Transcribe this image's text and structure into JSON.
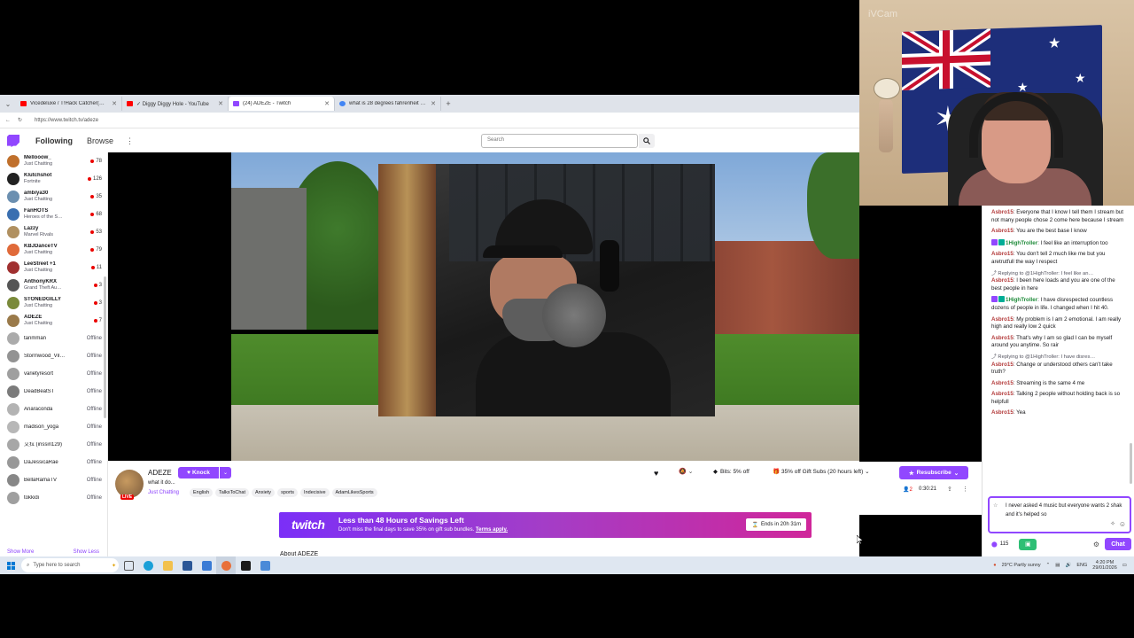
{
  "browser": {
    "tabs": [
      {
        "label": "Vicedeluxe / T!Hack Catcher(Ghost…",
        "color": "#ff0000"
      },
      {
        "label": "✓ Diggy Diggy Hole - YouTube",
        "color": "#ff0000"
      },
      {
        "label": "(24) ADEZE - Twitch",
        "color": "#9147ff"
      },
      {
        "label": "what is 28 degrees fahrenheit - G…",
        "color": "#4285f4"
      }
    ],
    "url": "https://www.twitch.tv/adeze"
  },
  "topnav": {
    "following": "Following",
    "browse": "Browse",
    "search_placeholder": "Search"
  },
  "sidebar": {
    "channels": [
      {
        "name": "Mellooow_",
        "game": "Just Chatting",
        "viewers": "78",
        "color": "#c0702c"
      },
      {
        "name": "Klutchshot",
        "game": "Fortnite",
        "viewers": "126",
        "color": "#222"
      },
      {
        "name": "ambiya30",
        "game": "Just Chatting",
        "viewers": "35",
        "color": "#6b8fb0"
      },
      {
        "name": "FanHOTS",
        "game": "Heroes of the S…",
        "viewers": "68",
        "color": "#3a6fb0"
      },
      {
        "name": "Lazzy",
        "game": "Marvel Rivals",
        "viewers": "53",
        "color": "#b09060"
      },
      {
        "name": "KBJDanceTV",
        "game": "Just Chatting",
        "viewers": "79",
        "color": "#e06a3a"
      },
      {
        "name": "LeeStreet +1",
        "game": "Just Chatting",
        "viewers": "11",
        "color": "#a03030"
      },
      {
        "name": "AnthonyKRX",
        "game": "Grand Theft Au…",
        "viewers": "3",
        "color": "#555"
      },
      {
        "name": "STONEDGILLY",
        "game": "Just Chatting",
        "viewers": "3",
        "color": "#7a8a3a"
      },
      {
        "name": "ADEZE",
        "game": "Just Chatting",
        "viewers": "7",
        "color": "#9a7a4a"
      }
    ],
    "offline": [
      {
        "name": "tanmman",
        "status": "Offline",
        "color": "#888"
      },
      {
        "name": "Stormwood_Vil…",
        "status": "Offline",
        "color": "#666"
      },
      {
        "name": "varietyresort",
        "status": "Offline",
        "color": "#777"
      },
      {
        "name": "DeadBeatST",
        "status": "Offline",
        "color": "#444"
      },
      {
        "name": "Anaraconda",
        "status": "Offline",
        "color": "#995"
      },
      {
        "name": "madison_yoga",
        "status": "Offline",
        "color": "#999"
      },
      {
        "name": "艾拉 (irissiri129)",
        "status": "Offline",
        "color": "#a77"
      },
      {
        "name": "DaJessicaRae",
        "status": "Offline",
        "color": "#866"
      },
      {
        "name": "BellaRamaTV",
        "status": "Offline",
        "color": "#555"
      },
      {
        "name": "tokkidi",
        "status": "Offline",
        "color": "#777"
      }
    ],
    "show_more": "Show More",
    "show_less": "Show Less"
  },
  "channel": {
    "name": "ADEZE",
    "knock": "Knock",
    "title": "what it do...",
    "category": "Just Chatting",
    "live": "LIVE",
    "tags": [
      "English",
      "TalksToChat",
      "Anxiety",
      "sports",
      "Indecisive",
      "AdamLikesSports"
    ],
    "bits": "Bits: 5% off",
    "gift_subs": "35% off Gift Subs (20 hours left)",
    "resubscribe": "Resubscribe",
    "viewers": "2",
    "uptime": "0:30:21"
  },
  "banner": {
    "brand": "twitch",
    "headline": "Less than 48 Hours of Savings Left",
    "sub": "Don't miss the final days to save 35% on gift sub bundles.",
    "terms": "Terms apply.",
    "ends": "Ends in 20h 31m"
  },
  "about_peek": "About ADEZE",
  "chat": {
    "messages": [
      {
        "user": "Asbro15",
        "text": ": Everyone that I know I tell them I stream but not many people chose 2 come here because I stream"
      },
      {
        "user": "Asbro15",
        "text": ": You are the best base I know"
      },
      {
        "user": "1HighTroller",
        "text": ": I feel like an interruption too"
      },
      {
        "user": "Asbro15",
        "text": ": You don't tell 2 much like me but you aretrutfull the way I respect"
      },
      {
        "reply": "Replying to @1HighTroller: I feel like an…",
        "user": "Asbro15",
        "text": ": I been here loads and you are one of the best people in here"
      },
      {
        "user": "1HighTroller",
        "text": ": I have disrespected countless dozens of people in life. I changed when I hit 40."
      },
      {
        "user": "Asbro15",
        "text": ": My problem is I am 2 emotional. I am really high and really low 2 quick"
      },
      {
        "user": "Asbro15",
        "text": ": That's why I am so glad I can be myself around you anytime. So rair"
      },
      {
        "reply": "Replying to @1HighTroller: I have disres…",
        "user": "Asbro15",
        "text": ": Change or understood others can't take truth?"
      },
      {
        "user": "Asbro15",
        "text": ": Streaming is the same 4 me"
      },
      {
        "user": "Asbro15",
        "text": ": Talking 2 people without holding back is so helpfull"
      },
      {
        "user": "Asbro15",
        "text": ": Yea"
      }
    ],
    "input": "I never asked 4 music but everyone wants 2 shak and it's helped so",
    "points": "115",
    "chat_button": "Chat"
  },
  "webcam": {
    "label": "iVCam"
  },
  "taskbar": {
    "search": "Type here to search",
    "weather": "29°C  Partly sunny",
    "lang": "ENG",
    "time": "4:20 PM",
    "date": "29/01/2026"
  }
}
